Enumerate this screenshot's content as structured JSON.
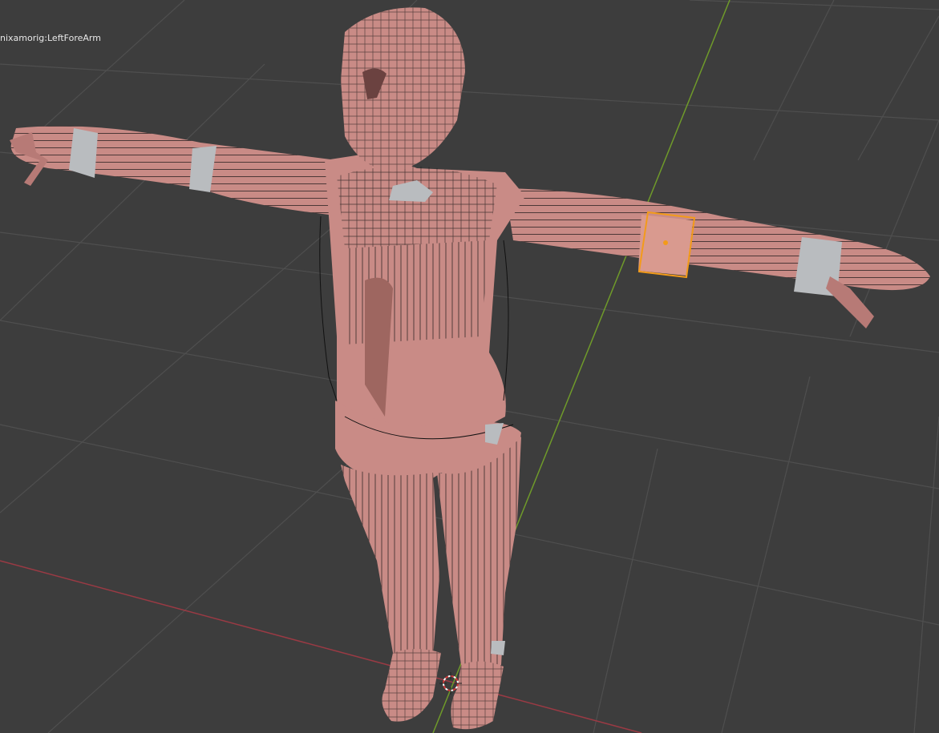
{
  "viewport": {
    "active_bone_label": "nixamorig:LeftForeArm",
    "colors": {
      "background": "#3d3d3d",
      "grid": "#4f4f4f",
      "x_axis": "#9a3a44",
      "y_axis": "#6f9a2a",
      "mesh_skin": "#c98b86",
      "mesh_skin_shadow": "#9e6660",
      "wire": "#111111",
      "bone_shape": "#b9bcbf",
      "selection": "#f39b1a",
      "cursor_red": "#d43a3a"
    },
    "icons": [
      "3d-cursor-icon"
    ]
  }
}
